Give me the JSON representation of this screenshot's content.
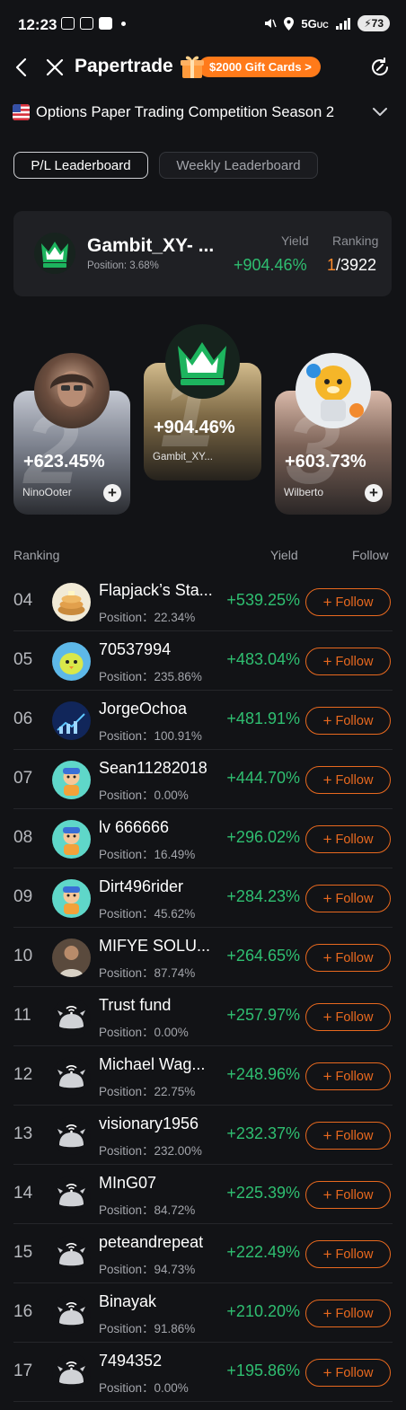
{
  "status_bar": {
    "time": "12:23",
    "network": "5G",
    "network_sub": "UC",
    "battery": "73"
  },
  "header": {
    "title": "Papertrade",
    "promo": "$2000 Gift Cards",
    "promo_arrow": ">"
  },
  "competition": {
    "title": "Options Paper Trading Competition Season 2",
    "flag": "us-flag"
  },
  "tabs": [
    {
      "label": "P/L Leaderboard",
      "active": true
    },
    {
      "label": "Weekly Leaderboard",
      "active": false
    }
  ],
  "me": {
    "name": "Gambit_XY- ...",
    "position": "Position: 3.68%",
    "yield_label": "Yield",
    "yield": "+904.46%",
    "ranking_label": "Ranking",
    "rank": "1",
    "rank_total": "/3922"
  },
  "podium": [
    {
      "place": "2",
      "yield": "+623.45%",
      "name": "NinoOoter",
      "plus": "+"
    },
    {
      "place": "1",
      "yield": "+904.46%",
      "name": "Gambit_XY..."
    },
    {
      "place": "3",
      "yield": "+603.73%",
      "name": "Wilberto",
      "plus": "+"
    }
  ],
  "list_header": {
    "ranking": "Ranking",
    "yield": "Yield",
    "follow": "Follow"
  },
  "follow_label": "Follow",
  "follow_plus": "+",
  "rows": [
    {
      "rank": "04",
      "name": "Flapjack’s Sta...",
      "position": "Position：22.34%",
      "yield": "+539.25%",
      "avatar": "pancake"
    },
    {
      "rank": "05",
      "name": "70537994",
      "position": "Position：235.86%",
      "yield": "+483.04%",
      "avatar": "chick"
    },
    {
      "rank": "06",
      "name": "JorgeOchoa",
      "position": "Position：100.91%",
      "yield": "+481.91%",
      "avatar": "chart"
    },
    {
      "rank": "07",
      "name": "Sean11282018",
      "position": "Position：0.00%",
      "yield": "+444.70%",
      "avatar": "character"
    },
    {
      "rank": "08",
      "name": "lv 666666",
      "position": "Position：16.49%",
      "yield": "+296.02%",
      "avatar": "character"
    },
    {
      "rank": "09",
      "name": "Dirt496rider",
      "position": "Position：45.62%",
      "yield": "+284.23%",
      "avatar": "character"
    },
    {
      "rank": "10",
      "name": "MIFYE SOLU...",
      "position": "Position：87.74%",
      "yield": "+264.65%",
      "avatar": "photo"
    },
    {
      "rank": "11",
      "name": "Trust fund",
      "position": "Position：0.00%",
      "yield": "+257.97%",
      "avatar": "default"
    },
    {
      "rank": "12",
      "name": "Michael Wag...",
      "position": "Position：22.75%",
      "yield": "+248.96%",
      "avatar": "default"
    },
    {
      "rank": "13",
      "name": "visionary1956",
      "position": "Position：232.00%",
      "yield": "+232.37%",
      "avatar": "default"
    },
    {
      "rank": "14",
      "name": "MInG07",
      "position": "Position：84.72%",
      "yield": "+225.39%",
      "avatar": "default"
    },
    {
      "rank": "15",
      "name": "peteandrepeat",
      "position": "Position：94.73%",
      "yield": "+222.49%",
      "avatar": "default"
    },
    {
      "rank": "16",
      "name": "Binayak",
      "position": "Position：91.86%",
      "yield": "+210.20%",
      "avatar": "default"
    },
    {
      "rank": "17",
      "name": "7494352",
      "position": "Position：0.00%",
      "yield": "+195.86%",
      "avatar": "default"
    }
  ],
  "colors": {
    "background": "#121316",
    "positive": "#2fbf71",
    "accent": "#e8691f",
    "rank_highlight": "#ff8b2c"
  }
}
